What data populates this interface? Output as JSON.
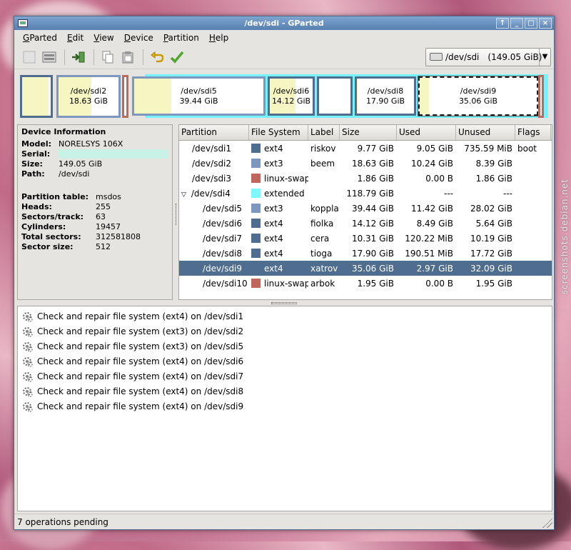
{
  "window": {
    "title": "/dev/sdi - GParted",
    "buttons": [
      "↑",
      "_",
      "□",
      "×"
    ]
  },
  "menu": [
    "GParted",
    "Edit",
    "View",
    "Device",
    "Partition",
    "Help"
  ],
  "menu_underline": [
    "G",
    "E",
    "V",
    "D",
    "P",
    "H"
  ],
  "toolbar": {
    "icons": [
      "new-partition-icon",
      "delete-partition-icon",
      "resize-move-icon",
      "copy-icon",
      "paste-icon",
      "undo-icon",
      "apply-icon"
    ],
    "device": "/dev/sdi",
    "device_size": "(149.05 GiB)"
  },
  "diskmap": [
    {
      "name": "",
      "size": "",
      "color": "#4f6d8e",
      "used": 0.92
    },
    {
      "name": "/dev/sdi2",
      "size": "18.63 GiB",
      "color": "#7d97bf",
      "used": 0.55
    },
    {
      "name": "",
      "size": "",
      "color": "#b86c5f",
      "used": 0
    },
    {
      "name": "/dev/sdi5",
      "size": "39.44 GiB",
      "color": "#7d97bf",
      "used": 0.29
    },
    {
      "name": "/dev/sdi6",
      "size": "14.12 GiB",
      "color": "#4f6d8e",
      "used": 0.6
    },
    {
      "name": "",
      "size": "",
      "color": "#4f6d8e",
      "used": 0
    },
    {
      "name": "/dev/sdi8",
      "size": "17.90 GiB",
      "color": "#4f6d8e",
      "used": 0.01
    },
    {
      "name": "/dev/sdi9",
      "size": "35.06 GiB",
      "color": "#222222",
      "used": 0.08
    },
    {
      "name": "",
      "size": "",
      "color": "#b86c5f",
      "used": 0
    }
  ],
  "device_info": {
    "heading": "Device Information",
    "rows": [
      {
        "k": "Model:",
        "v": "NORELSYS 106X"
      },
      {
        "k": "Serial:",
        "v": ""
      },
      {
        "k": "Size:",
        "v": "149.05 GiB"
      },
      {
        "k": "Path:",
        "v": "/dev/sdi"
      }
    ],
    "rows2": [
      {
        "k": "Partition table:",
        "v": "msdos"
      },
      {
        "k": "Heads:",
        "v": "255"
      },
      {
        "k": "Sectors/track:",
        "v": "63"
      },
      {
        "k": "Cylinders:",
        "v": "19457"
      },
      {
        "k": "Total sectors:",
        "v": "312581808"
      },
      {
        "k": "Sector size:",
        "v": "512"
      }
    ]
  },
  "table": {
    "headers": [
      "Partition",
      "File System",
      "Label",
      "Size",
      "Used",
      "Unused",
      "Flags"
    ],
    "rows": [
      {
        "partition": "/dev/sdi1",
        "indent": 0,
        "expander": "",
        "fs": "ext4",
        "fs_color": "#4f6d8e",
        "label": "riskov",
        "size": "9.77 GiB",
        "used": "9.05 GiB",
        "unused": "735.59 MiB",
        "flags": "boot",
        "selected": false
      },
      {
        "partition": "/dev/sdi2",
        "indent": 0,
        "expander": "",
        "fs": "ext3",
        "fs_color": "#7d97bf",
        "label": "beem",
        "size": "18.63 GiB",
        "used": "10.24 GiB",
        "unused": "8.39 GiB",
        "flags": "",
        "selected": false
      },
      {
        "partition": "/dev/sdi3",
        "indent": 0,
        "expander": "",
        "fs": "linux-swap",
        "fs_color": "#c1665a",
        "label": "",
        "size": "1.86 GiB",
        "used": "0.00 B",
        "unused": "1.86 GiB",
        "flags": "",
        "selected": false
      },
      {
        "partition": "/dev/sdi4",
        "indent": 0,
        "expander": "▽",
        "fs": "extended",
        "fs_color": "#7ff7ff",
        "label": "",
        "size": "118.79 GiB",
        "used": "---",
        "unused": "---",
        "flags": "",
        "selected": false
      },
      {
        "partition": "/dev/sdi5",
        "indent": 1,
        "expander": "",
        "fs": "ext3",
        "fs_color": "#7d97bf",
        "label": "koppla",
        "size": "39.44 GiB",
        "used": "11.42 GiB",
        "unused": "28.02 GiB",
        "flags": "",
        "selected": false
      },
      {
        "partition": "/dev/sdi6",
        "indent": 1,
        "expander": "",
        "fs": "ext4",
        "fs_color": "#4f6d8e",
        "label": "fiolka",
        "size": "14.12 GiB",
        "used": "8.49 GiB",
        "unused": "5.64 GiB",
        "flags": "",
        "selected": false
      },
      {
        "partition": "/dev/sdi7",
        "indent": 1,
        "expander": "",
        "fs": "ext4",
        "fs_color": "#4f6d8e",
        "label": "cera",
        "size": "10.31 GiB",
        "used": "120.22 MiB",
        "unused": "10.19 GiB",
        "flags": "",
        "selected": false
      },
      {
        "partition": "/dev/sdi8",
        "indent": 1,
        "expander": "",
        "fs": "ext4",
        "fs_color": "#4f6d8e",
        "label": "tioga",
        "size": "17.90 GiB",
        "used": "190.51 MiB",
        "unused": "17.72 GiB",
        "flags": "",
        "selected": false
      },
      {
        "partition": "/dev/sdi9",
        "indent": 1,
        "expander": "",
        "fs": "ext4",
        "fs_color": "#4f6d8e",
        "label": "xatrov",
        "size": "35.06 GiB",
        "used": "2.97 GiB",
        "unused": "32.09 GiB",
        "flags": "",
        "selected": true
      },
      {
        "partition": "/dev/sdi10",
        "indent": 1,
        "expander": "",
        "fs": "linux-swap",
        "fs_color": "#c1665a",
        "label": "arbok",
        "size": "1.95 GiB",
        "used": "0.00 B",
        "unused": "1.95 GiB",
        "flags": "",
        "selected": false
      }
    ]
  },
  "operations": [
    "Check and repair file system (ext4) on /dev/sdi1",
    "Check and repair file system (ext3) on /dev/sdi2",
    "Check and repair file system (ext3) on /dev/sdi5",
    "Check and repair file system (ext4) on /dev/sdi6",
    "Check and repair file system (ext4) on /dev/sdi7",
    "Check and repair file system (ext4) on /dev/sdi8",
    "Check and repair file system (ext4) on /dev/sdi9"
  ],
  "status": "7 operations pending",
  "watermark": "screenshots.debian.net"
}
